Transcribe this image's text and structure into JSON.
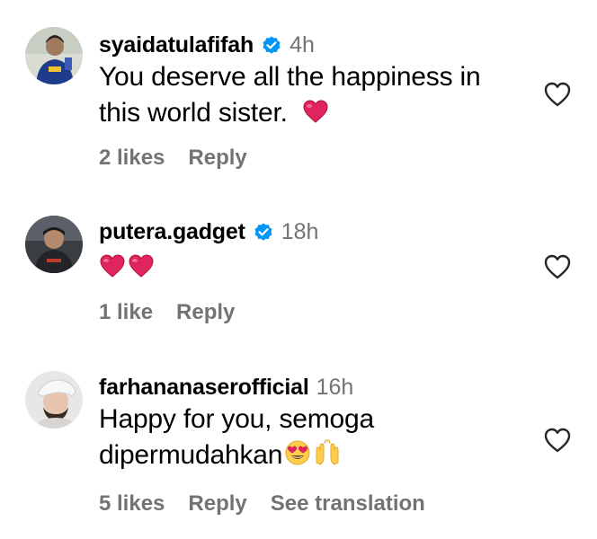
{
  "comments": [
    {
      "username": "syaidatulafifah",
      "verified": true,
      "time": "4h",
      "text_lines": [
        "You deserve all the happiness in",
        "this world sister."
      ],
      "emoji": [
        "red-heart"
      ],
      "likes": "2 likes",
      "reply": "Reply"
    },
    {
      "username": "putera.gadget",
      "verified": true,
      "time": "18h",
      "text_lines": [
        ""
      ],
      "emoji": [
        "red-heart",
        "red-heart"
      ],
      "likes": "1 like",
      "reply": "Reply"
    },
    {
      "username": "farhananaserofficial",
      "verified": false,
      "time": "16h",
      "text_lines": [
        "Happy for you, semoga",
        "dipermudahkan"
      ],
      "emoji": [
        "heart-eyes-face",
        "raising-hands"
      ],
      "likes": "5 likes",
      "reply": "Reply",
      "translate": "See translation"
    }
  ],
  "icons": {
    "verified_badge": "verified-badge-icon",
    "like": "heart-outline-icon"
  },
  "colors": {
    "verified_blue": "#0095f6",
    "muted_text": "#737373",
    "heart_red": "#e0245e"
  }
}
